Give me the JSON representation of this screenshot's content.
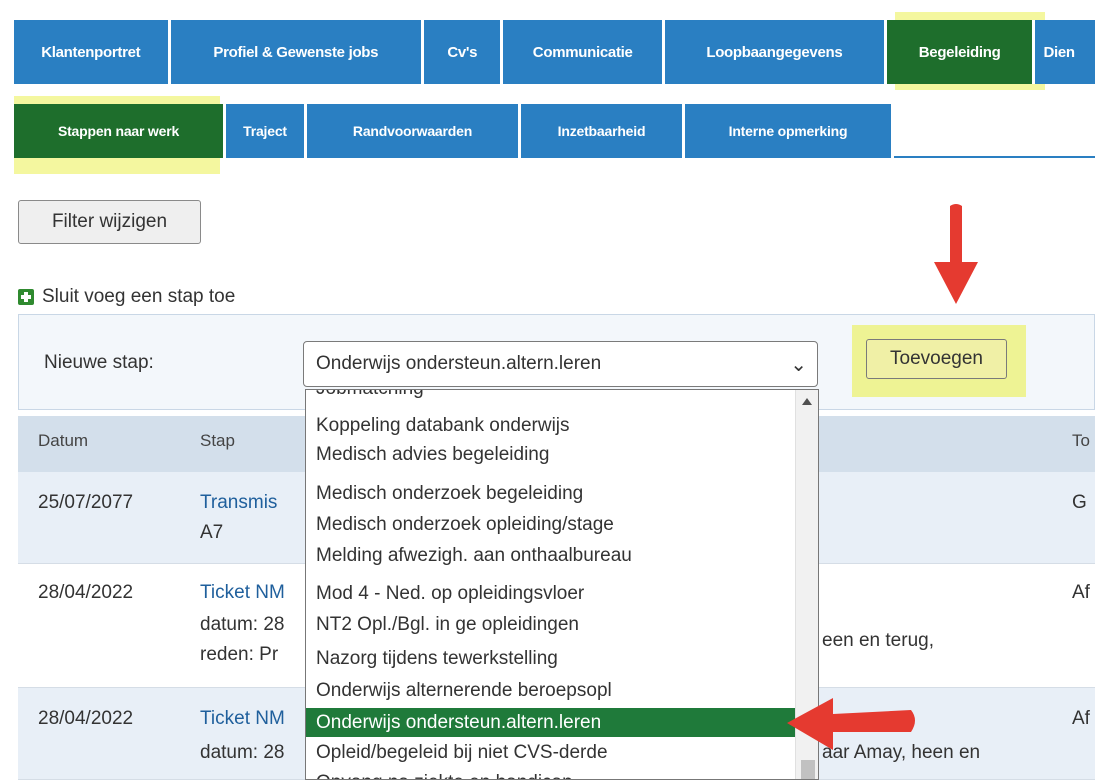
{
  "tabs_primary": [
    {
      "label": "Klantenportret"
    },
    {
      "label": "Profiel & Gewenste jobs"
    },
    {
      "label": "Cv's"
    },
    {
      "label": "Communicatie"
    },
    {
      "label": "Loopbaangegevens"
    },
    {
      "label": "Begeleiding",
      "active": true
    },
    {
      "label": "Dien"
    }
  ],
  "tabs_secondary": [
    {
      "label": "Stappen naar werk",
      "active": true
    },
    {
      "label": "Traject"
    },
    {
      "label": "Randvoorwaarden"
    },
    {
      "label": "Inzetbaarheid"
    },
    {
      "label": "Interne opmerking"
    }
  ],
  "filter_button": "Filter wijzigen",
  "add_step_link": "Sluit voeg een stap toe",
  "new_step": {
    "label": "Nieuwe stap:",
    "selected": "Onderwijs ondersteun.altern.leren",
    "add_button": "Toevoegen"
  },
  "dropdown_options": [
    "Jobmatching",
    "Koppeling databank onderwijs",
    "Medisch advies begeleiding",
    "Medisch onderzoek begeleiding",
    "Medisch onderzoek opleiding/stage",
    "Melding afwezigh. aan onthaalbureau",
    "Mod 4 - Ned. op opleidingsvloer",
    "NT2 Opl./Bgl. in ge opleidingen",
    "Nazorg tijdens tewerkstelling",
    "Onderwijs alternerende beroepsopl",
    "Onderwijs ondersteun.altern.leren",
    "Opleid/begeleid bij niet CVS-derde",
    "Opvang na ziekte en handicap"
  ],
  "table": {
    "headers": [
      "Datum",
      "Stap",
      "To"
    ],
    "rows": [
      {
        "date": "25/07/2077",
        "stap": "Transmis",
        "line2": "A7",
        "right": "",
        "to": "G"
      },
      {
        "date": "28/04/2022",
        "stap": "Ticket NM",
        "line2": "datum: 28",
        "line3": "reden: Pr",
        "right": "een en terug,",
        "to": "Af"
      },
      {
        "date": "28/04/2022",
        "stap": "Ticket NM",
        "line2": "datum: 28",
        "right": "aar Amay, heen en",
        "to": "Af"
      }
    ]
  },
  "colors": {
    "tab_blue": "#2a7fc2",
    "tab_active_green": "#1e6e2c",
    "highlight_yellow": "#ebf050",
    "arrow_red": "#e53a30"
  }
}
